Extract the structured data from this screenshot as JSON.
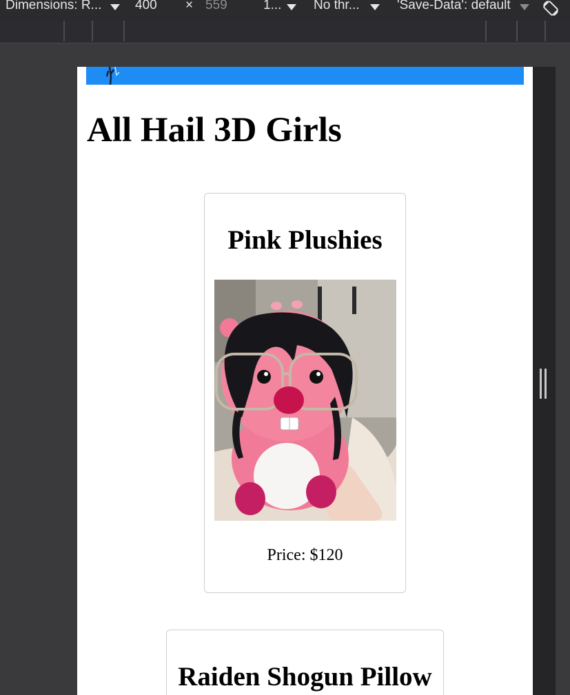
{
  "devtools": {
    "dimensions_label": "Dimensions: R...",
    "width_value": "400",
    "times_sign": "×",
    "height_value": "559",
    "zoom_label": "1...",
    "throttle_label": "No thr...",
    "save_data_label": "'Save-Data': default",
    "icons": [
      "caret-down-icon",
      "rotate-icon",
      "resize-handle-icon"
    ]
  },
  "page": {
    "title": "All Hail 3D Girls",
    "banner_color": "#1e8cf5"
  },
  "products": [
    {
      "name": "Pink Plushies",
      "price_text": "Price: $120",
      "image": "pink-plush-with-glasses"
    },
    {
      "name": "Raiden Shogun Pillow"
    }
  ]
}
